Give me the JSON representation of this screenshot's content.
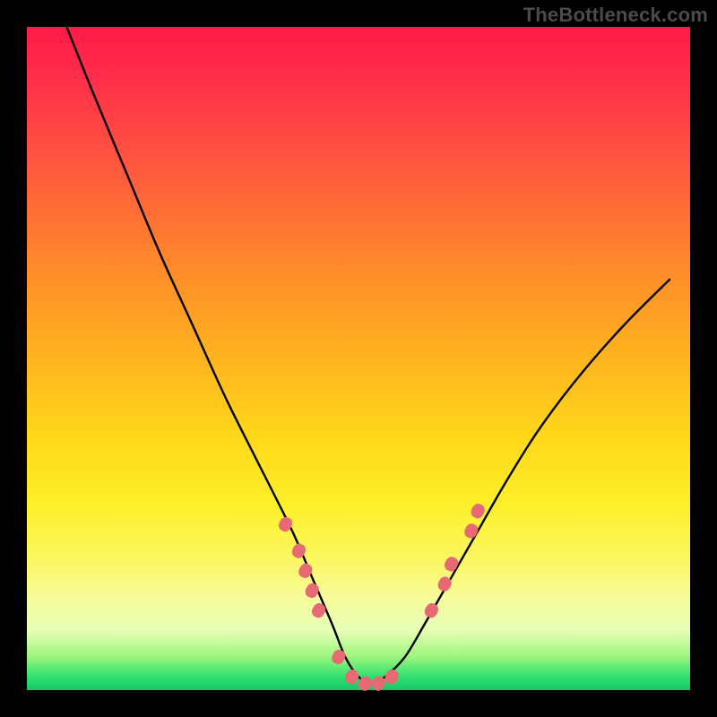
{
  "watermark": "TheBottleneck.com",
  "chart_data": {
    "type": "line",
    "title": "",
    "xlabel": "",
    "ylabel": "",
    "xlim": [
      0,
      100
    ],
    "ylim": [
      0,
      100
    ],
    "grid": false,
    "legend": false,
    "series": [
      {
        "name": "bottleneck-curve",
        "color": "#000000",
        "x": [
          6,
          10,
          15,
          20,
          25,
          30,
          35,
          40,
          43,
          46,
          48,
          50,
          52,
          54,
          57,
          60,
          64,
          68,
          72,
          77,
          83,
          90,
          97
        ],
        "y": [
          100,
          90,
          78,
          66,
          55,
          44,
          34,
          24,
          17,
          10,
          5,
          2,
          1,
          2,
          5,
          10,
          17,
          24,
          31,
          39,
          47,
          55,
          62
        ]
      }
    ],
    "markers": [
      {
        "name": "pink-dots",
        "color": "#e66a73",
        "points": [
          {
            "x": 39,
            "y": 25
          },
          {
            "x": 41,
            "y": 21
          },
          {
            "x": 42,
            "y": 18
          },
          {
            "x": 43,
            "y": 15
          },
          {
            "x": 44,
            "y": 12
          },
          {
            "x": 47,
            "y": 5
          },
          {
            "x": 49,
            "y": 2
          },
          {
            "x": 51,
            "y": 1
          },
          {
            "x": 53,
            "y": 1
          },
          {
            "x": 55,
            "y": 2
          },
          {
            "x": 61,
            "y": 12
          },
          {
            "x": 63,
            "y": 16
          },
          {
            "x": 64,
            "y": 19
          },
          {
            "x": 67,
            "y": 24
          },
          {
            "x": 68,
            "y": 27
          }
        ]
      }
    ],
    "background_gradient": {
      "top": "#ff1a48",
      "mid": "#ffd81a",
      "bottom": "#17c765"
    }
  }
}
